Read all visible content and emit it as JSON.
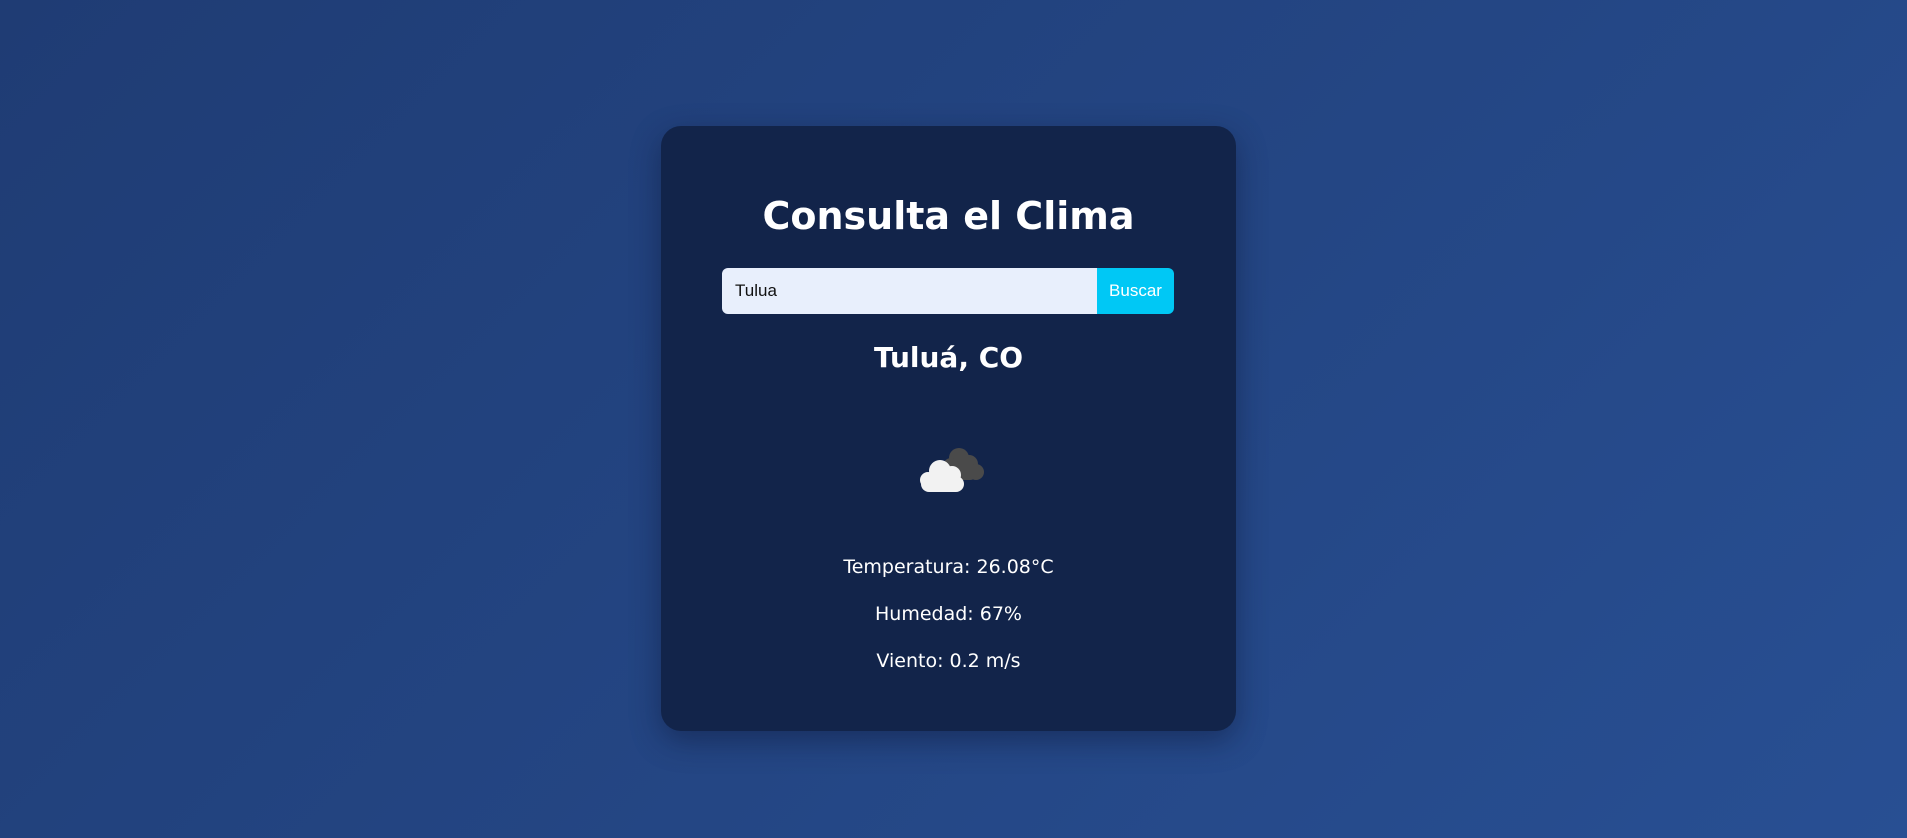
{
  "app": {
    "title": "Consulta el Clima"
  },
  "search": {
    "value": "Tulua",
    "button_label": "Buscar"
  },
  "weather": {
    "city": "Tuluá, CO",
    "icon": "broken-clouds-icon",
    "temperature_text": "Temperatura: 26.08°C",
    "humidity_text": "Humedad: 67%",
    "wind_text": "Viento: 0.2 m/s"
  },
  "colors": {
    "background": "#234282",
    "card": "#12244a",
    "accent": "#00c8f5",
    "input_bg": "#e8effc"
  }
}
